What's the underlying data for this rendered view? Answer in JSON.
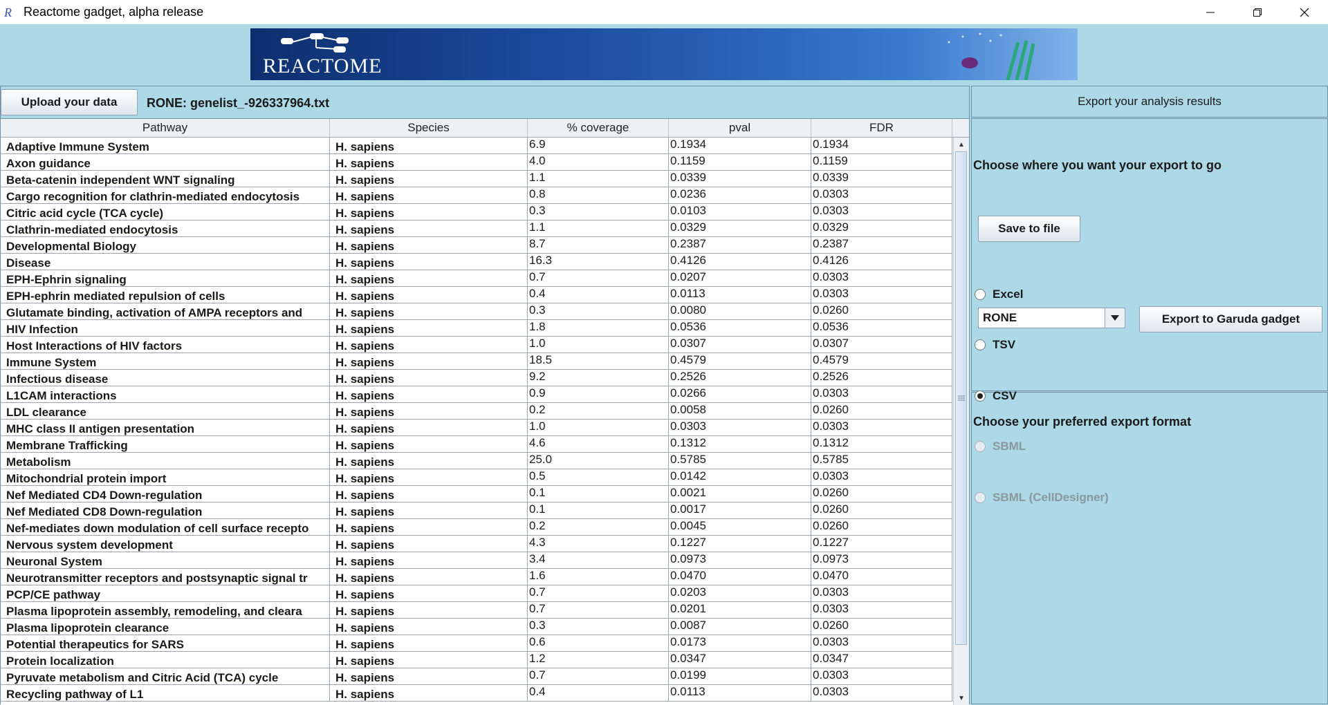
{
  "window": {
    "title": "Reactome gadget, alpha release"
  },
  "banner": {
    "logo_text": "REACTOME"
  },
  "left": {
    "upload_label": "Upload your data",
    "file_label": "RONE: genelist_-926337964.txt"
  },
  "table": {
    "headers": [
      "Pathway",
      "Species",
      "% coverage",
      "pval",
      "FDR"
    ],
    "rows": [
      [
        "Adaptive Immune System",
        "H. sapiens",
        "6.9",
        "0.1934",
        "0.1934"
      ],
      [
        "Axon guidance",
        "H. sapiens",
        "4.0",
        "0.1159",
        "0.1159"
      ],
      [
        "Beta-catenin independent WNT signaling",
        "H. sapiens",
        "1.1",
        "0.0339",
        "0.0339"
      ],
      [
        "Cargo recognition for clathrin-mediated endocytosis",
        "H. sapiens",
        "0.8",
        "0.0236",
        "0.0303"
      ],
      [
        "Citric acid cycle (TCA cycle)",
        "H. sapiens",
        "0.3",
        "0.0103",
        "0.0303"
      ],
      [
        "Clathrin-mediated endocytosis",
        "H. sapiens",
        "1.1",
        "0.0329",
        "0.0329"
      ],
      [
        "Developmental Biology",
        "H. sapiens",
        "8.7",
        "0.2387",
        "0.2387"
      ],
      [
        "Disease",
        "H. sapiens",
        "16.3",
        "0.4126",
        "0.4126"
      ],
      [
        "EPH-Ephrin signaling",
        "H. sapiens",
        "0.7",
        "0.0207",
        "0.0303"
      ],
      [
        "EPH-ephrin mediated repulsion of cells",
        "H. sapiens",
        "0.4",
        "0.0113",
        "0.0303"
      ],
      [
        "Glutamate binding, activation of AMPA receptors and",
        "H. sapiens",
        "0.3",
        "0.0080",
        "0.0260"
      ],
      [
        "HIV Infection",
        "H. sapiens",
        "1.8",
        "0.0536",
        "0.0536"
      ],
      [
        "Host Interactions of HIV factors",
        "H. sapiens",
        "1.0",
        "0.0307",
        "0.0307"
      ],
      [
        "Immune System",
        "H. sapiens",
        "18.5",
        "0.4579",
        "0.4579"
      ],
      [
        "Infectious disease",
        "H. sapiens",
        "9.2",
        "0.2526",
        "0.2526"
      ],
      [
        "L1CAM interactions",
        "H. sapiens",
        "0.9",
        "0.0266",
        "0.0303"
      ],
      [
        "LDL clearance",
        "H. sapiens",
        "0.2",
        "0.0058",
        "0.0260"
      ],
      [
        "MHC class II antigen presentation",
        "H. sapiens",
        "1.0",
        "0.0303",
        "0.0303"
      ],
      [
        "Membrane Trafficking",
        "H. sapiens",
        "4.6",
        "0.1312",
        "0.1312"
      ],
      [
        "Metabolism",
        "H. sapiens",
        "25.0",
        "0.5785",
        "0.5785"
      ],
      [
        "Mitochondrial protein import",
        "H. sapiens",
        "0.5",
        "0.0142",
        "0.0303"
      ],
      [
        "Nef Mediated CD4 Down-regulation",
        "H. sapiens",
        "0.1",
        "0.0021",
        "0.0260"
      ],
      [
        "Nef Mediated CD8 Down-regulation",
        "H. sapiens",
        "0.1",
        "0.0017",
        "0.0260"
      ],
      [
        "Nef-mediates down modulation of cell surface recepto",
        "H. sapiens",
        "0.2",
        "0.0045",
        "0.0260"
      ],
      [
        "Nervous system development",
        "H. sapiens",
        "4.3",
        "0.1227",
        "0.1227"
      ],
      [
        "Neuronal System",
        "H. sapiens",
        "3.4",
        "0.0973",
        "0.0973"
      ],
      [
        "Neurotransmitter receptors and postsynaptic signal tr",
        "H. sapiens",
        "1.6",
        "0.0470",
        "0.0470"
      ],
      [
        "PCP/CE pathway",
        "H. sapiens",
        "0.7",
        "0.0203",
        "0.0303"
      ],
      [
        "Plasma lipoprotein assembly, remodeling, and cleara",
        "H. sapiens",
        "0.7",
        "0.0201",
        "0.0303"
      ],
      [
        "Plasma lipoprotein clearance",
        "H. sapiens",
        "0.3",
        "0.0087",
        "0.0260"
      ],
      [
        "Potential therapeutics for SARS",
        "H. sapiens",
        "0.6",
        "0.0173",
        "0.0303"
      ],
      [
        "Protein localization",
        "H. sapiens",
        "1.2",
        "0.0347",
        "0.0347"
      ],
      [
        "Pyruvate metabolism and Citric Acid (TCA) cycle",
        "H. sapiens",
        "0.7",
        "0.0199",
        "0.0303"
      ],
      [
        "Recycling pathway of L1",
        "H. sapiens",
        "0.4",
        "0.0113",
        "0.0303"
      ]
    ]
  },
  "right": {
    "header": "Export your analysis results",
    "destination_title": "Choose where you want your export to go",
    "save_label": "Save to file",
    "dataset_select": "RONE",
    "garuda_label": "Export to Garuda gadget",
    "format_title": "Choose your preferred export format",
    "formats": [
      {
        "label": "Excel",
        "selected": false,
        "enabled": true
      },
      {
        "label": "TSV",
        "selected": false,
        "enabled": true
      },
      {
        "label": "CSV",
        "selected": true,
        "enabled": true
      },
      {
        "label": "SBML",
        "selected": false,
        "enabled": false
      },
      {
        "label": "SBML (CellDesigner)",
        "selected": false,
        "enabled": false
      }
    ]
  }
}
